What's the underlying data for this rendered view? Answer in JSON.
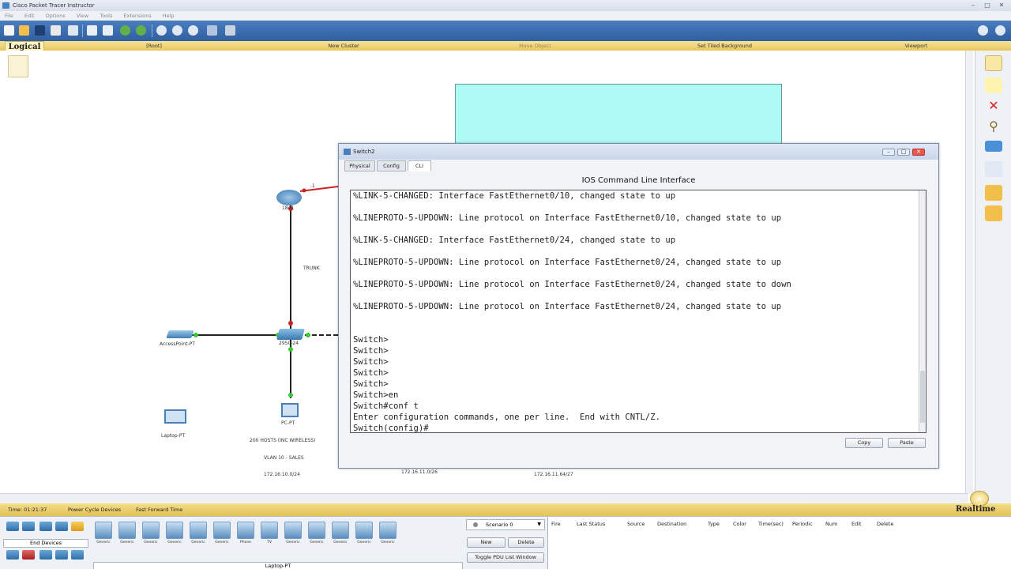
{
  "window": {
    "title": "Cisco Packet Tracer Instructor"
  },
  "menu": [
    "File",
    "Edit",
    "Options",
    "View",
    "Tools",
    "Extensions",
    "Help"
  ],
  "logical_bar": {
    "tab": "Logical",
    "root": "[Root]",
    "new_cluster": "New Cluster",
    "move_object": "Move Object",
    "set_tiled_background": "Set Tiled Background",
    "viewport": "Viewport"
  },
  "topology": {
    "router_label": "1841",
    "link_label": ".1",
    "trunk_label": "TRUNK",
    "switch_label": "2950-24",
    "access_point_label": "AccessPoint-PT",
    "pc_label": "PC-PT",
    "laptop_label": "Laptop-PT",
    "note_hosts": "200 HOSTS (INC WIRELESS)",
    "note_vlan": "VLAN 10 - SALES",
    "note_net1": "172.16.10.0/24",
    "note_net2": "172.16.11.0/26",
    "note_net3": "172.16.11.64/27"
  },
  "dialog": {
    "title": "Switch2",
    "tabs": [
      "Physical",
      "Config",
      "CLI"
    ],
    "heading": "IOS Command Line Interface",
    "terminal_lines": [
      "%LINK-5-CHANGED: Interface FastEthernet0/10, changed state to up",
      "",
      "%LINEPROTO-5-UPDOWN: Line protocol on Interface FastEthernet0/10, changed state to up",
      "",
      "%LINK-5-CHANGED: Interface FastEthernet0/24, changed state to up",
      "",
      "%LINEPROTO-5-UPDOWN: Line protocol on Interface FastEthernet0/24, changed state to up",
      "",
      "%LINEPROTO-5-UPDOWN: Line protocol on Interface FastEthernet0/24, changed state to down",
      "",
      "%LINEPROTO-5-UPDOWN: Line protocol on Interface FastEthernet0/24, changed state to up",
      "",
      "",
      "Switch>",
      "Switch>",
      "Switch>",
      "Switch>",
      "Switch>",
      "Switch>en",
      "Switch#conf t",
      "Enter configuration commands, one per line.  End with CNTL/Z.",
      "Switch(config)#"
    ],
    "copy_label": "Copy",
    "paste_label": "Paste"
  },
  "status": {
    "time": "Time: 01:21:37",
    "power_cycle": "Power Cycle Devices",
    "fast_forward": "Fast Forward Time",
    "realtime": "Realtime"
  },
  "bottom": {
    "category_label": "End Devices",
    "device_names": [
      "Generic",
      "Generic",
      "Generic",
      "Generic",
      "Generic",
      "Generic",
      "Phone",
      "TV",
      "Generic",
      "Generic",
      "Generic",
      "Generic",
      "Generic"
    ],
    "selected_device": "Laptop-PT",
    "scenario": "Scenario 0",
    "new_label": "New",
    "delete_label": "Delete",
    "toggle_pdu": "Toggle PDU List Window",
    "pdu_columns": [
      "Fire",
      "Last Status",
      "Source",
      "Destination",
      "Type",
      "Color",
      "Time(sec)",
      "Periodic",
      "Num",
      "Edit",
      "Delete"
    ]
  }
}
